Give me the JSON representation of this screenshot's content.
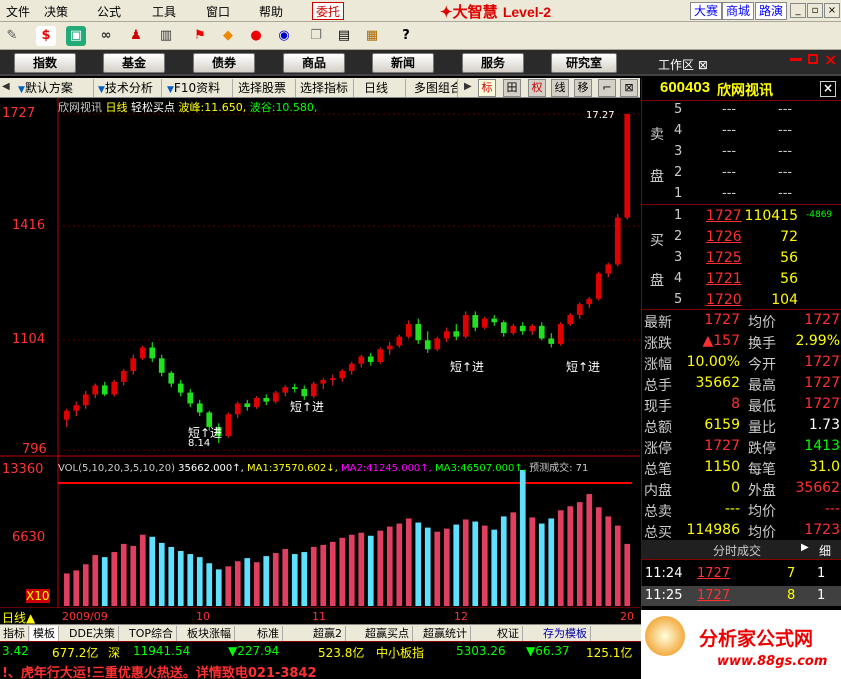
{
  "menu": {
    "items": [
      "文件",
      "决策",
      "公式",
      "工具",
      "窗口",
      "帮助"
    ],
    "weituo": "委托",
    "brand_cn": "大智慧",
    "brand_lv": "Level-2",
    "right_btns": [
      "大赛",
      "商城",
      "路演"
    ]
  },
  "nav": {
    "buttons": [
      "指数",
      "基金",
      "债券",
      "商品",
      "新闻",
      "服务",
      "研究室"
    ],
    "workarea": "工作区"
  },
  "tabs": {
    "items": [
      "默认方案",
      "技术分析",
      "F10资料",
      "选择股票",
      "选择指标",
      "日线",
      "多图组合"
    ],
    "tools": [
      "标",
      "田",
      "权",
      "线",
      "移",
      "⌐",
      "⊠"
    ]
  },
  "chart": {
    "stock_label": "欣网视讯",
    "period_label": "日线",
    "formula": "轻松买点",
    "wave_peak_label": "波峰:",
    "wave_peak": "11.650,",
    "wave_trough_label": "波谷:",
    "wave_trough": "10.580,",
    "price_ticks": [
      "1727",
      "1416",
      "1104",
      "796"
    ],
    "marker_high": "17.27",
    "marker_low": "8.14",
    "signal_text": "短↑进",
    "vol_line": "VOL(5,10,20,3,5,10,20)",
    "vol_value": "35662.000↑,",
    "ma1_label": "MA1:",
    "ma1": "37570.602↓,",
    "ma2_label": "MA2:",
    "ma2": "41245.000↑,",
    "ma3_label": "MA3:",
    "ma3": "46507.000↑,",
    "forecast": "预测成交: 71",
    "vol_ticks": [
      "13360",
      "6630"
    ],
    "vol_unit": "X10",
    "period_bottom": "日线",
    "date_ticks": [
      "2009/09",
      "10",
      "11",
      "12",
      "20"
    ]
  },
  "chart_data": {
    "type": "candlestick",
    "title": "",
    "price_axis": [
      796,
      1104,
      1416,
      1727
    ],
    "candles": [
      [
        880,
        910,
        860,
        905
      ],
      [
        905,
        930,
        890,
        920
      ],
      [
        920,
        960,
        910,
        950
      ],
      [
        950,
        980,
        940,
        975
      ],
      [
        975,
        985,
        945,
        950
      ],
      [
        950,
        990,
        945,
        985
      ],
      [
        985,
        1020,
        975,
        1015
      ],
      [
        1015,
        1060,
        1005,
        1050
      ],
      [
        1050,
        1085,
        1045,
        1080
      ],
      [
        1080,
        1095,
        1040,
        1050
      ],
      [
        1050,
        1060,
        1000,
        1010
      ],
      [
        1010,
        1015,
        970,
        980
      ],
      [
        980,
        990,
        945,
        955
      ],
      [
        955,
        965,
        915,
        925
      ],
      [
        925,
        935,
        890,
        900
      ],
      [
        900,
        905,
        850,
        860
      ],
      [
        860,
        870,
        815,
        835
      ],
      [
        835,
        900,
        830,
        895
      ],
      [
        895,
        930,
        885,
        925
      ],
      [
        925,
        935,
        905,
        915
      ],
      [
        915,
        945,
        910,
        940
      ],
      [
        940,
        950,
        920,
        930
      ],
      [
        930,
        960,
        925,
        955
      ],
      [
        955,
        975,
        945,
        970
      ],
      [
        970,
        980,
        955,
        965
      ],
      [
        965,
        975,
        935,
        945
      ],
      [
        945,
        985,
        940,
        980
      ],
      [
        980,
        995,
        965,
        990
      ],
      [
        990,
        1005,
        975,
        995
      ],
      [
        995,
        1020,
        985,
        1015
      ],
      [
        1015,
        1040,
        1005,
        1035
      ],
      [
        1035,
        1060,
        1025,
        1055
      ],
      [
        1055,
        1065,
        1030,
        1040
      ],
      [
        1040,
        1080,
        1035,
        1075
      ],
      [
        1075,
        1095,
        1060,
        1085
      ],
      [
        1085,
        1115,
        1080,
        1110
      ],
      [
        1110,
        1155,
        1105,
        1145
      ],
      [
        1145,
        1160,
        1090,
        1100
      ],
      [
        1100,
        1125,
        1065,
        1075
      ],
      [
        1075,
        1110,
        1070,
        1105
      ],
      [
        1105,
        1135,
        1095,
        1125
      ],
      [
        1125,
        1145,
        1100,
        1110
      ],
      [
        1110,
        1180,
        1105,
        1170
      ],
      [
        1170,
        1180,
        1125,
        1135
      ],
      [
        1135,
        1165,
        1130,
        1160
      ],
      [
        1160,
        1170,
        1140,
        1150
      ],
      [
        1150,
        1155,
        1110,
        1120
      ],
      [
        1120,
        1145,
        1115,
        1140
      ],
      [
        1140,
        1150,
        1115,
        1125
      ],
      [
        1125,
        1145,
        1115,
        1140
      ],
      [
        1140,
        1150,
        1100,
        1105
      ],
      [
        1105,
        1120,
        1080,
        1090
      ],
      [
        1090,
        1150,
        1085,
        1145
      ],
      [
        1145,
        1175,
        1140,
        1170
      ],
      [
        1170,
        1205,
        1160,
        1200
      ],
      [
        1200,
        1220,
        1190,
        1215
      ],
      [
        1215,
        1290,
        1210,
        1285
      ],
      [
        1285,
        1315,
        1275,
        1310
      ],
      [
        1310,
        1450,
        1305,
        1440
      ],
      [
        1440,
        1727,
        1435,
        1727
      ]
    ],
    "volumes": [
      3200,
      3500,
      4100,
      5000,
      4800,
      5300,
      6100,
      5900,
      7000,
      6800,
      6200,
      5800,
      5400,
      5100,
      4800,
      4200,
      3600,
      3900,
      4400,
      4700,
      4300,
      4900,
      5200,
      5600,
      5100,
      5300,
      5800,
      6000,
      6300,
      6700,
      7000,
      7200,
      6900,
      7400,
      7800,
      8100,
      8600,
      8200,
      7700,
      7300,
      7600,
      8000,
      8500,
      8300,
      7900,
      7500,
      8800,
      9200,
      13360,
      8700,
      8100,
      8600,
      9400,
      9800,
      10200,
      11000,
      9700,
      8800,
      7900,
      6100
    ],
    "vol_axis": [
      6630,
      13360
    ]
  },
  "quote": {
    "code": "600403",
    "name": "欣网视讯",
    "sell_label": [
      "卖",
      "盘"
    ],
    "buy_label": [
      "买",
      "盘"
    ],
    "sell": [
      {
        "lvl": "5",
        "price": "---",
        "vol": "---"
      },
      {
        "lvl": "4",
        "price": "---",
        "vol": "---"
      },
      {
        "lvl": "3",
        "price": "---",
        "vol": "---"
      },
      {
        "lvl": "2",
        "price": "---",
        "vol": "---"
      },
      {
        "lvl": "1",
        "price": "---",
        "vol": "---"
      }
    ],
    "buy": [
      {
        "lvl": "1",
        "price": "1727",
        "vol": "110415",
        "chg": "-4869"
      },
      {
        "lvl": "2",
        "price": "1726",
        "vol": "72",
        "chg": ""
      },
      {
        "lvl": "3",
        "price": "1725",
        "vol": "56",
        "chg": ""
      },
      {
        "lvl": "4",
        "price": "1721",
        "vol": "56",
        "chg": ""
      },
      {
        "lvl": "5",
        "price": "1720",
        "vol": "104",
        "chg": ""
      }
    ],
    "stats": [
      {
        "k1": "最新",
        "v1": "1727",
        "k2": "均价",
        "v2": "1727"
      },
      {
        "k1": "涨跌",
        "v1": "▲157",
        "k2": "换手",
        "v2": "2.99%"
      },
      {
        "k1": "涨幅",
        "v1": "10.00%",
        "k2": "今开",
        "v2": "1727"
      },
      {
        "k1": "总手",
        "v1": "35662",
        "k2": "最高",
        "v2": "1727"
      },
      {
        "k1": "现手",
        "v1": "8",
        "k2": "最低",
        "v2": "1727"
      },
      {
        "k1": "总额",
        "v1": "6159",
        "k2": "量比",
        "v2": "1.73"
      },
      {
        "k1": "涨停",
        "v1": "1727",
        "k2": "跌停",
        "v2": "1413"
      },
      {
        "k1": "总笔",
        "v1": "1150",
        "k2": "每笔",
        "v2": "31.0"
      },
      {
        "k1": "内盘",
        "v1": "0",
        "k2": "外盘",
        "v2": "35662"
      },
      {
        "k1": "总卖",
        "v1": "---",
        "k2": "均价",
        "v2": "---"
      },
      {
        "k1": "总买",
        "v1": "114986",
        "k2": "均价",
        "v2": "1723"
      }
    ],
    "trade_header": "分时成交",
    "trade_sub": "细",
    "trades": [
      {
        "t": "11:24",
        "p": "1727",
        "v": "7",
        "n": "1"
      },
      {
        "t": "11:25",
        "p": "1727",
        "v": "8",
        "n": "1"
      }
    ]
  },
  "bottom_tabs": [
    "指标",
    "模板",
    "DDE决策",
    "TOP综合",
    "板块涨幅",
    "标准",
    "超赢2",
    "超赢买点",
    "超赢统计",
    "权证",
    "存为模板"
  ],
  "index_bar": {
    "v1": "3.42",
    "amt1": "677.2亿",
    "mk2": "深",
    "v2": "11941.54",
    "c2": "▼227.94",
    "amt2": "523.8亿",
    "mk3": "中小板指",
    "v3": "5303.26",
    "c3": "▼66.37",
    "amt3": "125.1亿"
  },
  "ticker": "!、虎年行大运!三重优惠火热送。详情致电021-3842",
  "logo": {
    "name": "分析家公式网",
    "url": "www.88gs.com"
  }
}
